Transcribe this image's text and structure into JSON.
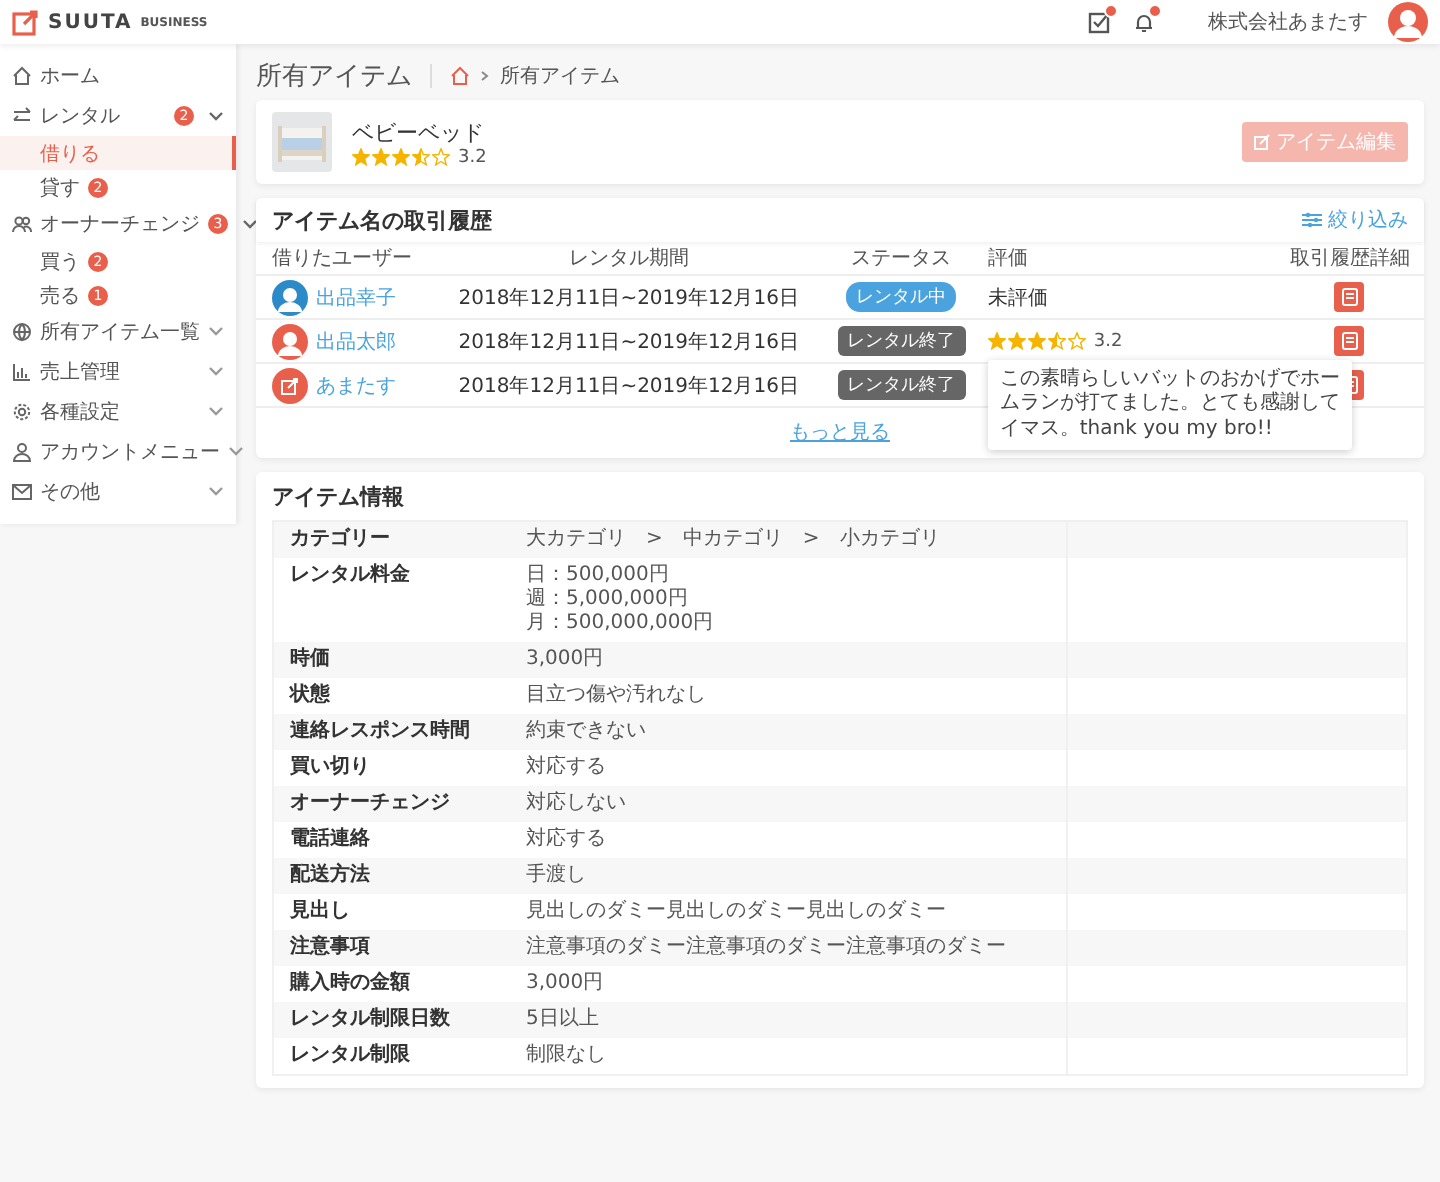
{
  "header": {
    "logo": "SUUTA",
    "logo_sub": "BUSINESS",
    "company": "株式会社あまたす"
  },
  "sidebar": {
    "items": [
      {
        "label": "ホーム"
      },
      {
        "label": "レンタル",
        "badge": "2",
        "expanded": true,
        "children": [
          {
            "label": "借りる",
            "selected": true
          },
          {
            "label": "貸す",
            "selected": false,
            "badge": "2"
          }
        ]
      },
      {
        "label": "オーナーチェンジ",
        "badge": "3",
        "expanded": true,
        "children": [
          {
            "label": "買う",
            "selected": false,
            "badge": "2"
          },
          {
            "label": "売る",
            "selected": false,
            "badge": "1"
          }
        ]
      },
      {
        "label": "所有アイテム一覧",
        "expanded": false
      },
      {
        "label": "売上管理",
        "expanded": false
      },
      {
        "label": "各種設定",
        "expanded": false
      },
      {
        "label": "アカウントメニュー",
        "expanded": false
      },
      {
        "label": "その他",
        "expanded": false
      }
    ]
  },
  "page": {
    "title": "所有アイテム",
    "breadcrumb": [
      "所有アイテム"
    ]
  },
  "item": {
    "name": "ベビーベッド",
    "stars": 3.5,
    "rating": "3.2",
    "edit_button": "アイテム編集",
    "edit_disabled": true
  },
  "history": {
    "title": "アイテム名の取引履歴",
    "filter": "絞り込み",
    "columns": [
      "借りたユーザー",
      "レンタル期間",
      "ステータス",
      "評価",
      "取引履歴詳細"
    ],
    "rows": [
      {
        "user": "出品幸子",
        "period": "2018年12月11日~2019年12月16日",
        "status": "レンタル中",
        "active": true,
        "rating_text": "未評価"
      },
      {
        "user": "出品太郎",
        "period": "2018年12月11日~2019年12月16日",
        "status": "レンタル終了",
        "active": false,
        "stars": 3.5,
        "rating_text": "3.2",
        "tooltip": "この素晴らしいバットのおかげでホームランが打てました。とても感謝してイマス。thank you my bro!!"
      },
      {
        "user": "あまたす",
        "period": "2018年12月11日~2019年12月16日",
        "status": "レンタル終了",
        "active": false
      }
    ],
    "more": "もっと見る"
  },
  "info": {
    "title": "アイテム情報",
    "rows": [
      {
        "label": "カテゴリー",
        "values": [
          "大カテゴリ　>　中カテゴリ　>　小カテゴリ"
        ]
      },
      {
        "label": "レンタル料金",
        "values": [
          "日：500,000円",
          "週：5,000,000円",
          "月：500,000,000円"
        ]
      },
      {
        "label": "時価",
        "values": [
          "3,000円"
        ]
      },
      {
        "label": "状態",
        "values": [
          "目立つ傷や汚れなし"
        ]
      },
      {
        "label": "連絡レスポンス時間",
        "values": [
          "約束できない"
        ]
      },
      {
        "label": "買い切り",
        "values": [
          "対応する"
        ]
      },
      {
        "label": "オーナーチェンジ",
        "values": [
          "対応しない"
        ]
      },
      {
        "label": "電話連絡",
        "values": [
          "対応する"
        ]
      },
      {
        "label": "配送方法",
        "values": [
          "手渡し"
        ]
      },
      {
        "label": "見出し",
        "values": [
          "見出しのダミー見出しのダミー見出しのダミー"
        ]
      },
      {
        "label": "注意事項",
        "values": [
          "注意事項のダミー注意事項のダミー注意事項のダミー"
        ]
      },
      {
        "label": "購入時の金額",
        "values": [
          "3,000円"
        ]
      },
      {
        "label": "レンタル制限日数",
        "values": [
          "5日以上"
        ]
      },
      {
        "label": "レンタル制限",
        "values": [
          "制限なし"
        ]
      }
    ]
  }
}
